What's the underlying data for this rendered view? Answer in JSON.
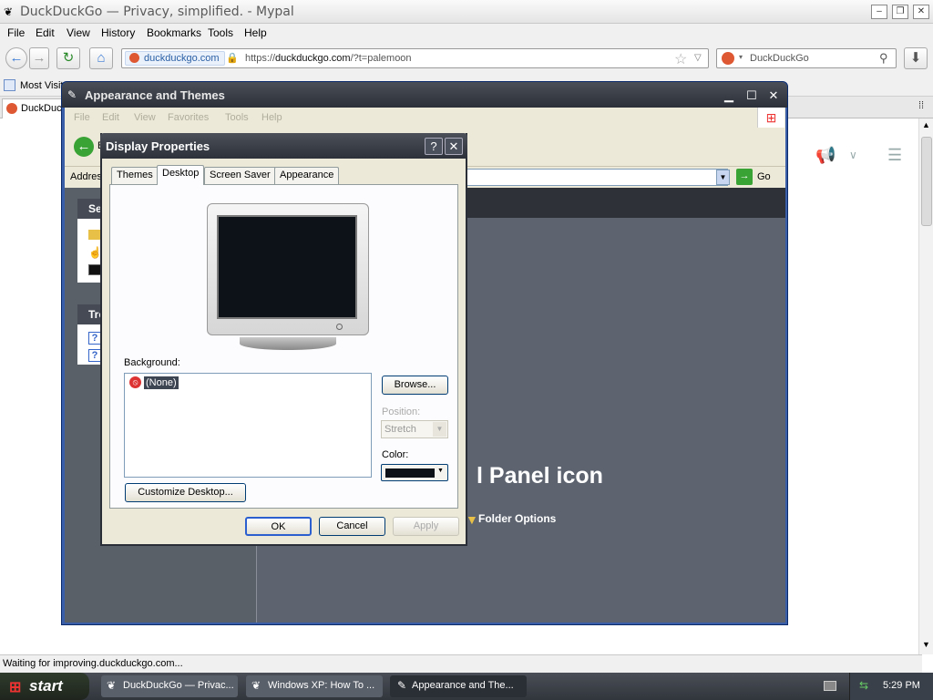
{
  "browser": {
    "title": "DuckDuckGo — Privacy, simplified. - Mypal",
    "menu": [
      "File",
      "Edit",
      "View",
      "History",
      "Bookmarks",
      "Tools",
      "Help"
    ],
    "site_label": "duckduckgo.com",
    "url_scheme": "https://",
    "url_host": "duckduckgo.com",
    "url_path": "/?t=palemoon",
    "search_placeholder": "DuckDuckGo",
    "bookmark_item": "Most Visit",
    "tab_label": "DuckDuck",
    "status": "Waiting for improving.duckduckgo.com..."
  },
  "xp_window": {
    "title": "Appearance and Themes",
    "menu": [
      "File",
      "Edit",
      "View",
      "Favorites",
      "Tools",
      "Help"
    ],
    "back_label": "B",
    "address_label": "Address",
    "go_label": "Go",
    "left_panel_1": "Se",
    "left_panel_2": "Tro",
    "main_heading": "l Panel icon",
    "folder_options": "Folder Options"
  },
  "dialog": {
    "title": "Display Properties",
    "help_glyph": "?",
    "close_glyph": "✕",
    "tabs": [
      "Themes",
      "Desktop",
      "Screen Saver",
      "Appearance"
    ],
    "background_label": "Background:",
    "bg_selected": "(None)",
    "browse_label": "Browse...",
    "position_label": "Position:",
    "position_value": "Stretch",
    "color_label": "Color:",
    "color_value": "#0d1118",
    "customize_label": "Customize Desktop...",
    "ok_label": "OK",
    "cancel_label": "Cancel",
    "apply_label": "Apply"
  },
  "taskbar": {
    "start_label": "start",
    "tasks": [
      "DuckDuckGo — Privac...",
      "Windows XP: How To ...",
      "Appearance and The..."
    ],
    "clock": "5:29 PM"
  }
}
